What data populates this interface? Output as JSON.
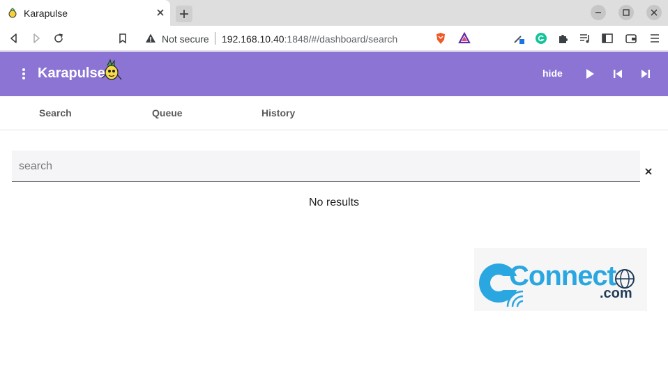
{
  "browser": {
    "tab_title": "Karapulse",
    "not_secure_label": "Not secure",
    "url_host": "192.168.10.40",
    "url_rest": ":1848/#/dashboard/search"
  },
  "app": {
    "brand": "Karapulse",
    "hide_label": "hide",
    "accent_color": "#8b74d4"
  },
  "nav_tabs": [
    {
      "label": "Search"
    },
    {
      "label": "Queue"
    },
    {
      "label": "History"
    }
  ],
  "search": {
    "placeholder": "search",
    "value": ""
  },
  "results": {
    "empty_text": "No results"
  },
  "watermark": {
    "main": "Connect",
    "suffix": ".com"
  },
  "icons": {
    "menu": "more-vert-icon",
    "play": "play-icon",
    "previous": "skip-previous-icon",
    "next": "skip-next-icon",
    "clear": "close-icon"
  }
}
